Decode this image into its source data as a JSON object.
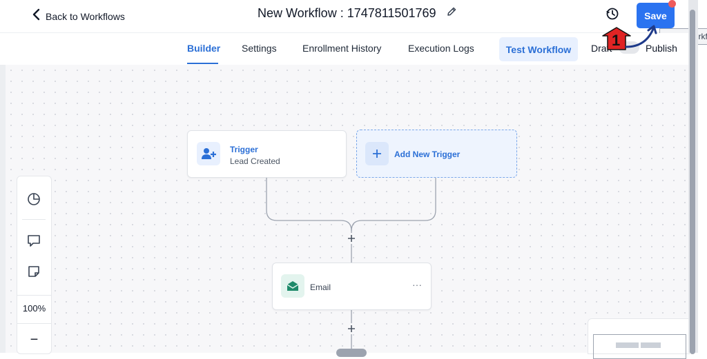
{
  "header": {
    "back_label": "Back to Workflows",
    "title": "New Workflow : 1747811501769",
    "save_label": "Save",
    "tooltip": "Save Workflow"
  },
  "tabs": [
    {
      "label": "Builder",
      "active": true
    },
    {
      "label": "Settings"
    },
    {
      "label": "Enrollment History"
    },
    {
      "label": "Execution Logs"
    }
  ],
  "actions": {
    "test_label": "Test Workflow",
    "draft_label": "Draft",
    "publish_label": "Publish"
  },
  "nodes": {
    "trigger": {
      "title": "Trigger",
      "subtitle": "Lead Created"
    },
    "add_trigger": {
      "label": "Add New Trigger"
    },
    "email": {
      "label": "Email",
      "menu": "···"
    }
  },
  "zoom": {
    "level": "100%",
    "minus": "−"
  },
  "annotation": {
    "step": "1"
  },
  "colors": {
    "accent": "#2b6fd6",
    "save_bg": "#2b73f0",
    "email_icon": "#1e8a6a",
    "notification": "#ef5b5b"
  }
}
